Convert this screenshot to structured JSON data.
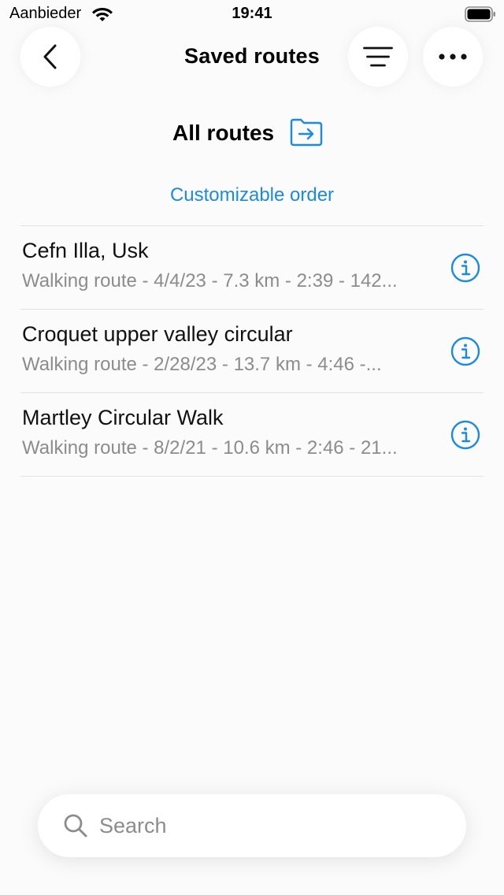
{
  "status_bar": {
    "carrier": "Aanbieder",
    "time": "19:41"
  },
  "header": {
    "title": "Saved routes",
    "back_icon": "chevron-left-icon",
    "filter_icon": "sort-lines-icon",
    "more_icon": "ellipsis-icon"
  },
  "folder": {
    "title": "All routes",
    "icon": "folder-arrow-icon"
  },
  "order_label": "Customizable order",
  "routes": [
    {
      "name": "Cefn Illa, Usk",
      "details": "Walking route - 4/4/23 - 7.3 km - 2:39 - 142..."
    },
    {
      "name": "Croquet upper valley circular",
      "details": "Walking route - 2/28/23 - 13.7 km - 4:46 -..."
    },
    {
      "name": "Martley Circular Walk",
      "details": "Walking route - 8/2/21 - 10.6 km - 2:46 - 21..."
    }
  ],
  "search": {
    "placeholder": "Search",
    "value": ""
  },
  "colors": {
    "accent": "#1b8ae6",
    "secondary_text": "#8c8c8c",
    "background": "#fbfbfb"
  }
}
